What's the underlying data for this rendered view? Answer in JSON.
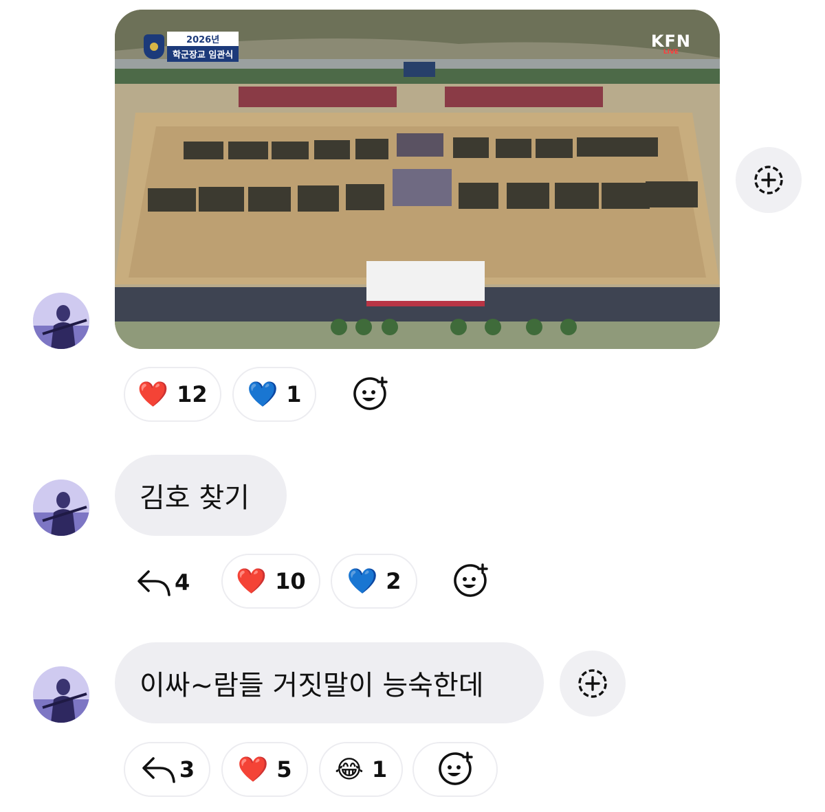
{
  "media": {
    "overlay_badge_year": "2026년",
    "overlay_badge_title": "학군장교 임관식",
    "broadcaster": "KFN",
    "broadcaster_sub": "LIVE"
  },
  "message1": {
    "reactions": [
      {
        "emoji": "❤️",
        "count": "12"
      },
      {
        "emoji": "💙",
        "count": "1"
      }
    ]
  },
  "message2": {
    "text": "김호 찾기",
    "reply_count": "4",
    "reactions": [
      {
        "emoji": "❤️",
        "count": "10"
      },
      {
        "emoji": "💙",
        "count": "2"
      }
    ]
  },
  "message3": {
    "text": "이싸~람들 거짓말이 능숙한데",
    "reply_count": "3",
    "reactions": [
      {
        "emoji": "❤️",
        "count": "5"
      },
      {
        "emoji": "😂",
        "count": "1"
      }
    ]
  },
  "colors": {
    "heart_red": "#e0223a",
    "heart_blue": "#2d6cf0",
    "bubble_bg": "#eeeef2",
    "pill_border": "#ececf0"
  }
}
